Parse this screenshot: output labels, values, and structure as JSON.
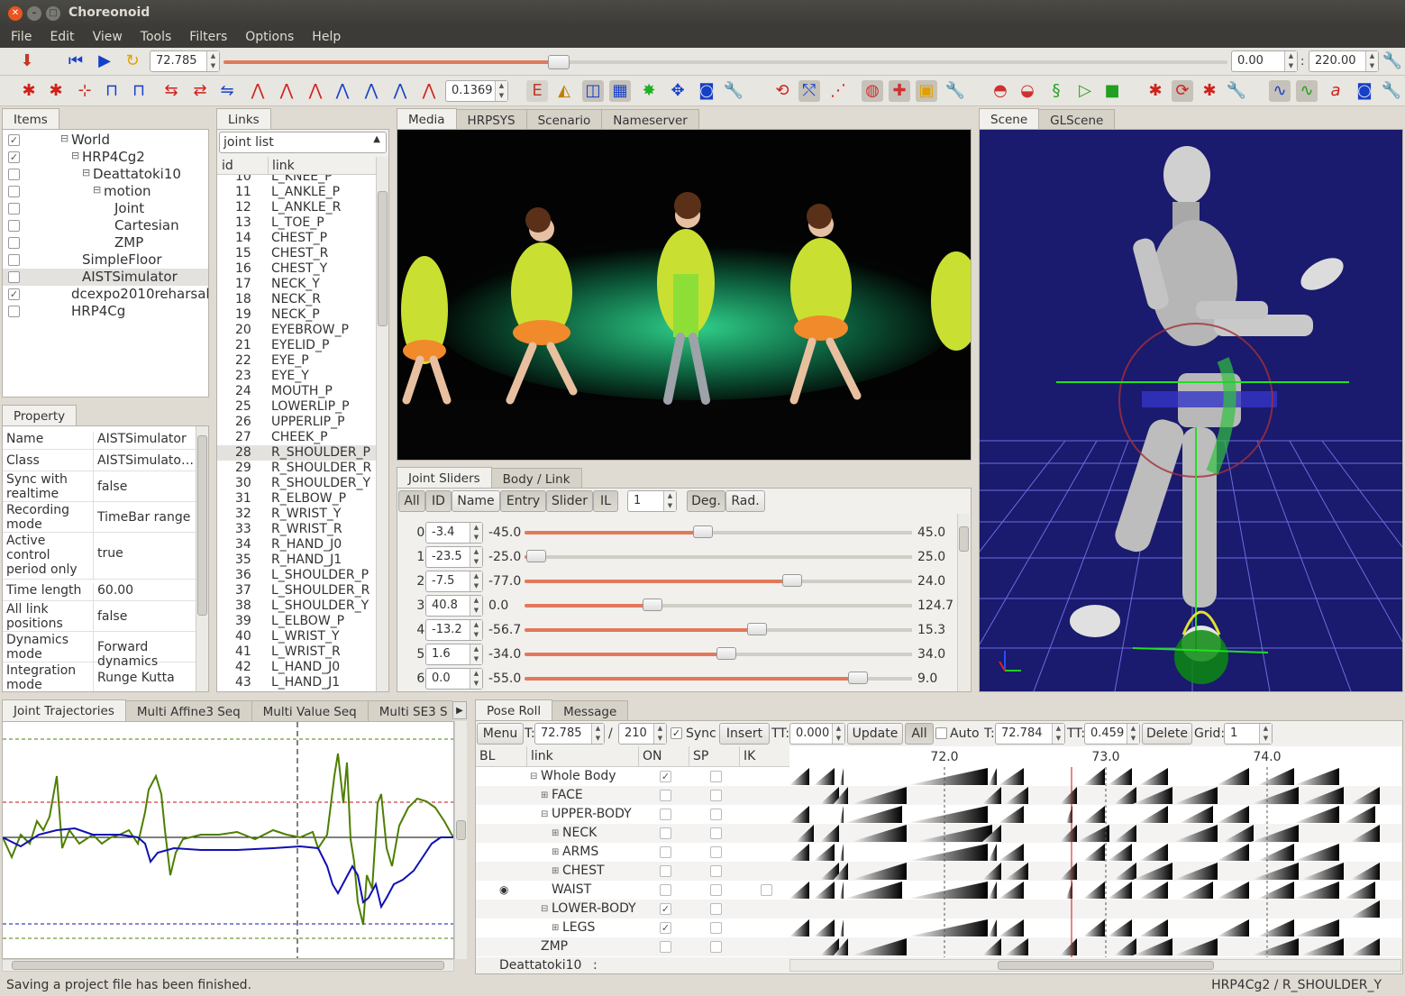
{
  "window": {
    "title": "Choreonoid"
  },
  "menu": [
    "File",
    "Edit",
    "View",
    "Tools",
    "Filters",
    "Options",
    "Help"
  ],
  "timebar": {
    "time": "72.785",
    "start": "0.00",
    "end": "220.00",
    "time_pos_fraction": 0.33,
    "range_sep": ":"
  },
  "toolbar2": {
    "gap_value": "0.1369"
  },
  "items_panel": {
    "tab": "Items",
    "items": [
      {
        "label": "World",
        "checked": true,
        "depth": 0,
        "expander": "-"
      },
      {
        "label": "HRP4Cg2",
        "checked": true,
        "depth": 1,
        "expander": "-"
      },
      {
        "label": "Deattatoki10",
        "checked": false,
        "depth": 2,
        "expander": "-"
      },
      {
        "label": "motion",
        "checked": false,
        "depth": 3,
        "expander": "-"
      },
      {
        "label": "Joint",
        "checked": false,
        "depth": 4,
        "expander": ""
      },
      {
        "label": "Cartesian",
        "checked": false,
        "depth": 4,
        "expander": ""
      },
      {
        "label": "ZMP",
        "checked": false,
        "depth": 4,
        "expander": ""
      },
      {
        "label": "SimpleFloor",
        "checked": false,
        "depth": 1,
        "expander": ""
      },
      {
        "label": "AISTSimulator",
        "checked": false,
        "depth": 1,
        "expander": "",
        "selected": true
      },
      {
        "label": "dcexpo2010reharsal",
        "checked": true,
        "depth": 0,
        "expander": ""
      },
      {
        "label": "HRP4Cg",
        "checked": false,
        "depth": 0,
        "expander": ""
      }
    ]
  },
  "property_panel": {
    "tab": "Property",
    "rows": [
      {
        "key": "Name",
        "value": "AISTSimulator"
      },
      {
        "key": "Class",
        "value": "AISTSimulato…"
      },
      {
        "key": "Sync with realtime",
        "value": "false"
      },
      {
        "key": "Recording mode",
        "value": "TimeBar range"
      },
      {
        "key": "Active control period only",
        "value": "true"
      },
      {
        "key": "Time length",
        "value": "60.00"
      },
      {
        "key": "All link positions",
        "value": "false"
      },
      {
        "key": "Dynamics mode",
        "value": "Forward dynamics"
      },
      {
        "key": "Integration mode",
        "value": "Runge Kutta"
      }
    ]
  },
  "links_panel": {
    "tab": "Links",
    "combo": "joint list",
    "col_id": "id",
    "col_link": "link",
    "rows": [
      [
        "10",
        "L_KNEE_P"
      ],
      [
        "11",
        "L_ANKLE_P"
      ],
      [
        "12",
        "L_ANKLE_R"
      ],
      [
        "13",
        "L_TOE_P"
      ],
      [
        "14",
        "CHEST_P"
      ],
      [
        "15",
        "CHEST_R"
      ],
      [
        "16",
        "CHEST_Y"
      ],
      [
        "17",
        "NECK_Y"
      ],
      [
        "18",
        "NECK_R"
      ],
      [
        "19",
        "NECK_P"
      ],
      [
        "20",
        "EYEBROW_P"
      ],
      [
        "21",
        "EYELID_P"
      ],
      [
        "22",
        "EYE_P"
      ],
      [
        "23",
        "EYE_Y"
      ],
      [
        "24",
        "MOUTH_P"
      ],
      [
        "25",
        "LOWERLIP_P"
      ],
      [
        "26",
        "UPPERLIP_P"
      ],
      [
        "27",
        "CHEEK_P"
      ],
      [
        "28",
        "R_SHOULDER_P"
      ],
      [
        "29",
        "R_SHOULDER_R"
      ],
      [
        "30",
        "R_SHOULDER_Y"
      ],
      [
        "31",
        "R_ELBOW_P"
      ],
      [
        "32",
        "R_WRIST_Y"
      ],
      [
        "33",
        "R_WRIST_R"
      ],
      [
        "34",
        "R_HAND_J0"
      ],
      [
        "35",
        "R_HAND_J1"
      ],
      [
        "36",
        "L_SHOULDER_P"
      ],
      [
        "37",
        "L_SHOULDER_R"
      ],
      [
        "38",
        "L_SHOULDER_Y"
      ],
      [
        "39",
        "L_ELBOW_P"
      ],
      [
        "40",
        "L_WRIST_Y"
      ],
      [
        "41",
        "L_WRIST_R"
      ],
      [
        "42",
        "L_HAND_J0"
      ],
      [
        "43",
        "L_HAND_J1"
      ]
    ],
    "selected_id": "28"
  },
  "media_tabs": [
    "Media",
    "HRPSYS",
    "Scenario",
    "Nameserver"
  ],
  "scene_tabs": [
    "Scene",
    "GLScene"
  ],
  "joint_sliders": {
    "tabs": [
      "Joint Sliders",
      "Body / Link"
    ],
    "buttons": [
      "All",
      "ID",
      "Name",
      "Entry",
      "Slider",
      "IL"
    ],
    "num": "1",
    "units": [
      "Deg.",
      "Rad."
    ],
    "rows": [
      {
        "idx": "0:",
        "value": "-3.4",
        "min": "-45.0",
        "max": "45.0",
        "frac": 0.46
      },
      {
        "idx": "1:",
        "value": "-23.5",
        "min": "-25.0",
        "max": "25.0",
        "frac": 0.03
      },
      {
        "idx": "2:",
        "value": "-7.5",
        "min": "-77.0",
        "max": "24.0",
        "frac": 0.69
      },
      {
        "idx": "3:",
        "value": "40.8",
        "min": "0.0",
        "max": "124.7",
        "frac": 0.33
      },
      {
        "idx": "4:",
        "value": "-13.2",
        "min": "-56.7",
        "max": "15.3",
        "frac": 0.6
      },
      {
        "idx": "5:",
        "value": "1.6",
        "min": "-34.0",
        "max": "34.0",
        "frac": 0.52
      },
      {
        "idx": "6:",
        "value": "0.0",
        "min": "-55.0",
        "max": "9.0",
        "frac": 0.86
      }
    ]
  },
  "traj_tabs": [
    "Joint Trajectories",
    "Multi Affine3 Seq",
    "Multi Value Seq",
    "Multi SE3 S"
  ],
  "pose_roll": {
    "tabs": [
      "Pose Roll",
      "Message"
    ],
    "menu": "Menu",
    "t_label": "T:",
    "time": "72.785",
    "slash": "/",
    "total": "210",
    "sync": "Sync",
    "insert": "Insert",
    "tt_label": "TT:",
    "tt": "0.000",
    "update": "Update",
    "all": "All",
    "auto": "Auto",
    "t2_label": "T:",
    "t2": "72.784",
    "tt2_label": "TT:",
    "tt2": "0.459",
    "delete": "Delete",
    "grid_label": "Grid:",
    "grid": "1",
    "cols": [
      "BL",
      "link",
      "ON",
      "SP",
      "IK"
    ],
    "ticks": [
      "72.0",
      "73.0",
      "74.0"
    ],
    "rows": [
      {
        "label": "Whole Body",
        "depth": 0,
        "exp": "-",
        "on": true,
        "bl": false
      },
      {
        "label": "FACE",
        "depth": 1,
        "exp": "+",
        "on": false,
        "bl": false
      },
      {
        "label": "UPPER-BODY",
        "depth": 1,
        "exp": "-",
        "on": false,
        "bl": false
      },
      {
        "label": "NECK",
        "depth": 2,
        "exp": "+",
        "on": false,
        "bl": false
      },
      {
        "label": "ARMS",
        "depth": 2,
        "exp": "+",
        "on": false,
        "bl": false
      },
      {
        "label": "CHEST",
        "depth": 2,
        "exp": "+",
        "on": false,
        "bl": false
      },
      {
        "label": "WAIST",
        "depth": 1,
        "exp": "",
        "on": false,
        "bl": true
      },
      {
        "label": "LOWER-BODY",
        "depth": 1,
        "exp": "-",
        "on": true,
        "bl": false
      },
      {
        "label": "LEGS",
        "depth": 2,
        "exp": "+",
        "on": true,
        "bl": false
      },
      {
        "label": "ZMP",
        "depth": 0,
        "exp": "",
        "on": false,
        "bl": false
      }
    ],
    "footer": "Deattatoki10",
    "footer_sep": ":"
  },
  "status": {
    "left": "Saving a project file has been finished.",
    "right": "HRP4Cg2 / R_SHOULDER_Y"
  },
  "colors": {
    "scene_bg": "#1a1a6e",
    "slider_fill": "#e1795a",
    "traj_green": "#4d7f00",
    "traj_blue": "#1010b0"
  },
  "icons": [
    "load-icon",
    "play-from-start-icon",
    "play-icon",
    "refresh-icon",
    "settings-icon",
    "fk-icon",
    "ik-icon",
    "camera-icon",
    "render-icon"
  ]
}
